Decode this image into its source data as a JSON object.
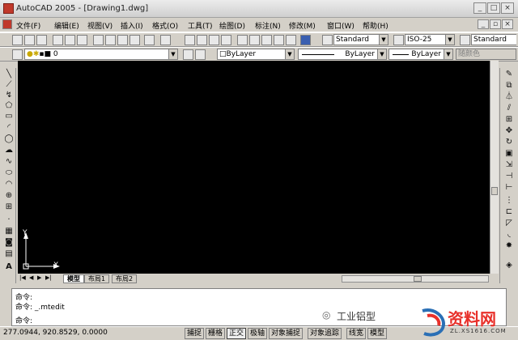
{
  "window": {
    "title": "AutoCAD 2005 - [Drawing1.dwg]"
  },
  "menu": [
    "文件(F)",
    "编辑(E)",
    "视图(V)",
    "插入(I)",
    "格式(O)",
    "工具(T)",
    "绘图(D)",
    "标注(N)",
    "修改(M)",
    "窗口(W)",
    "帮助(H)"
  ],
  "toolbar1": {
    "text_style": "Standard",
    "dim_style": "ISO-25",
    "table_style": "Standard"
  },
  "toolbar2": {
    "layer": "0",
    "color": "ByLayer",
    "linetype": "ByLayer",
    "lineweight": "ByLayer",
    "plotstyle": "随颜色"
  },
  "ucs": {
    "y_label": "Y",
    "x_label": "X"
  },
  "tabs": [
    "模型",
    "布局1",
    "布局2"
  ],
  "command": {
    "line1": "命令:",
    "line2": "命令: _.mtedit",
    "line3": "命令:"
  },
  "status": {
    "coords": "277.0944, 920.8529, 0.0000",
    "buttons": [
      "捕捉",
      "栅格",
      "正交",
      "极轴",
      "对象捕捉",
      "对象追踪",
      "线宽",
      "模型"
    ]
  },
  "watermark": {
    "source": "工业铝型",
    "site_big": "资料网",
    "site_small": "ZL.XS1616.COM"
  },
  "colors": {
    "canvas": "#000000",
    "watermark_red": "#e8302a"
  }
}
